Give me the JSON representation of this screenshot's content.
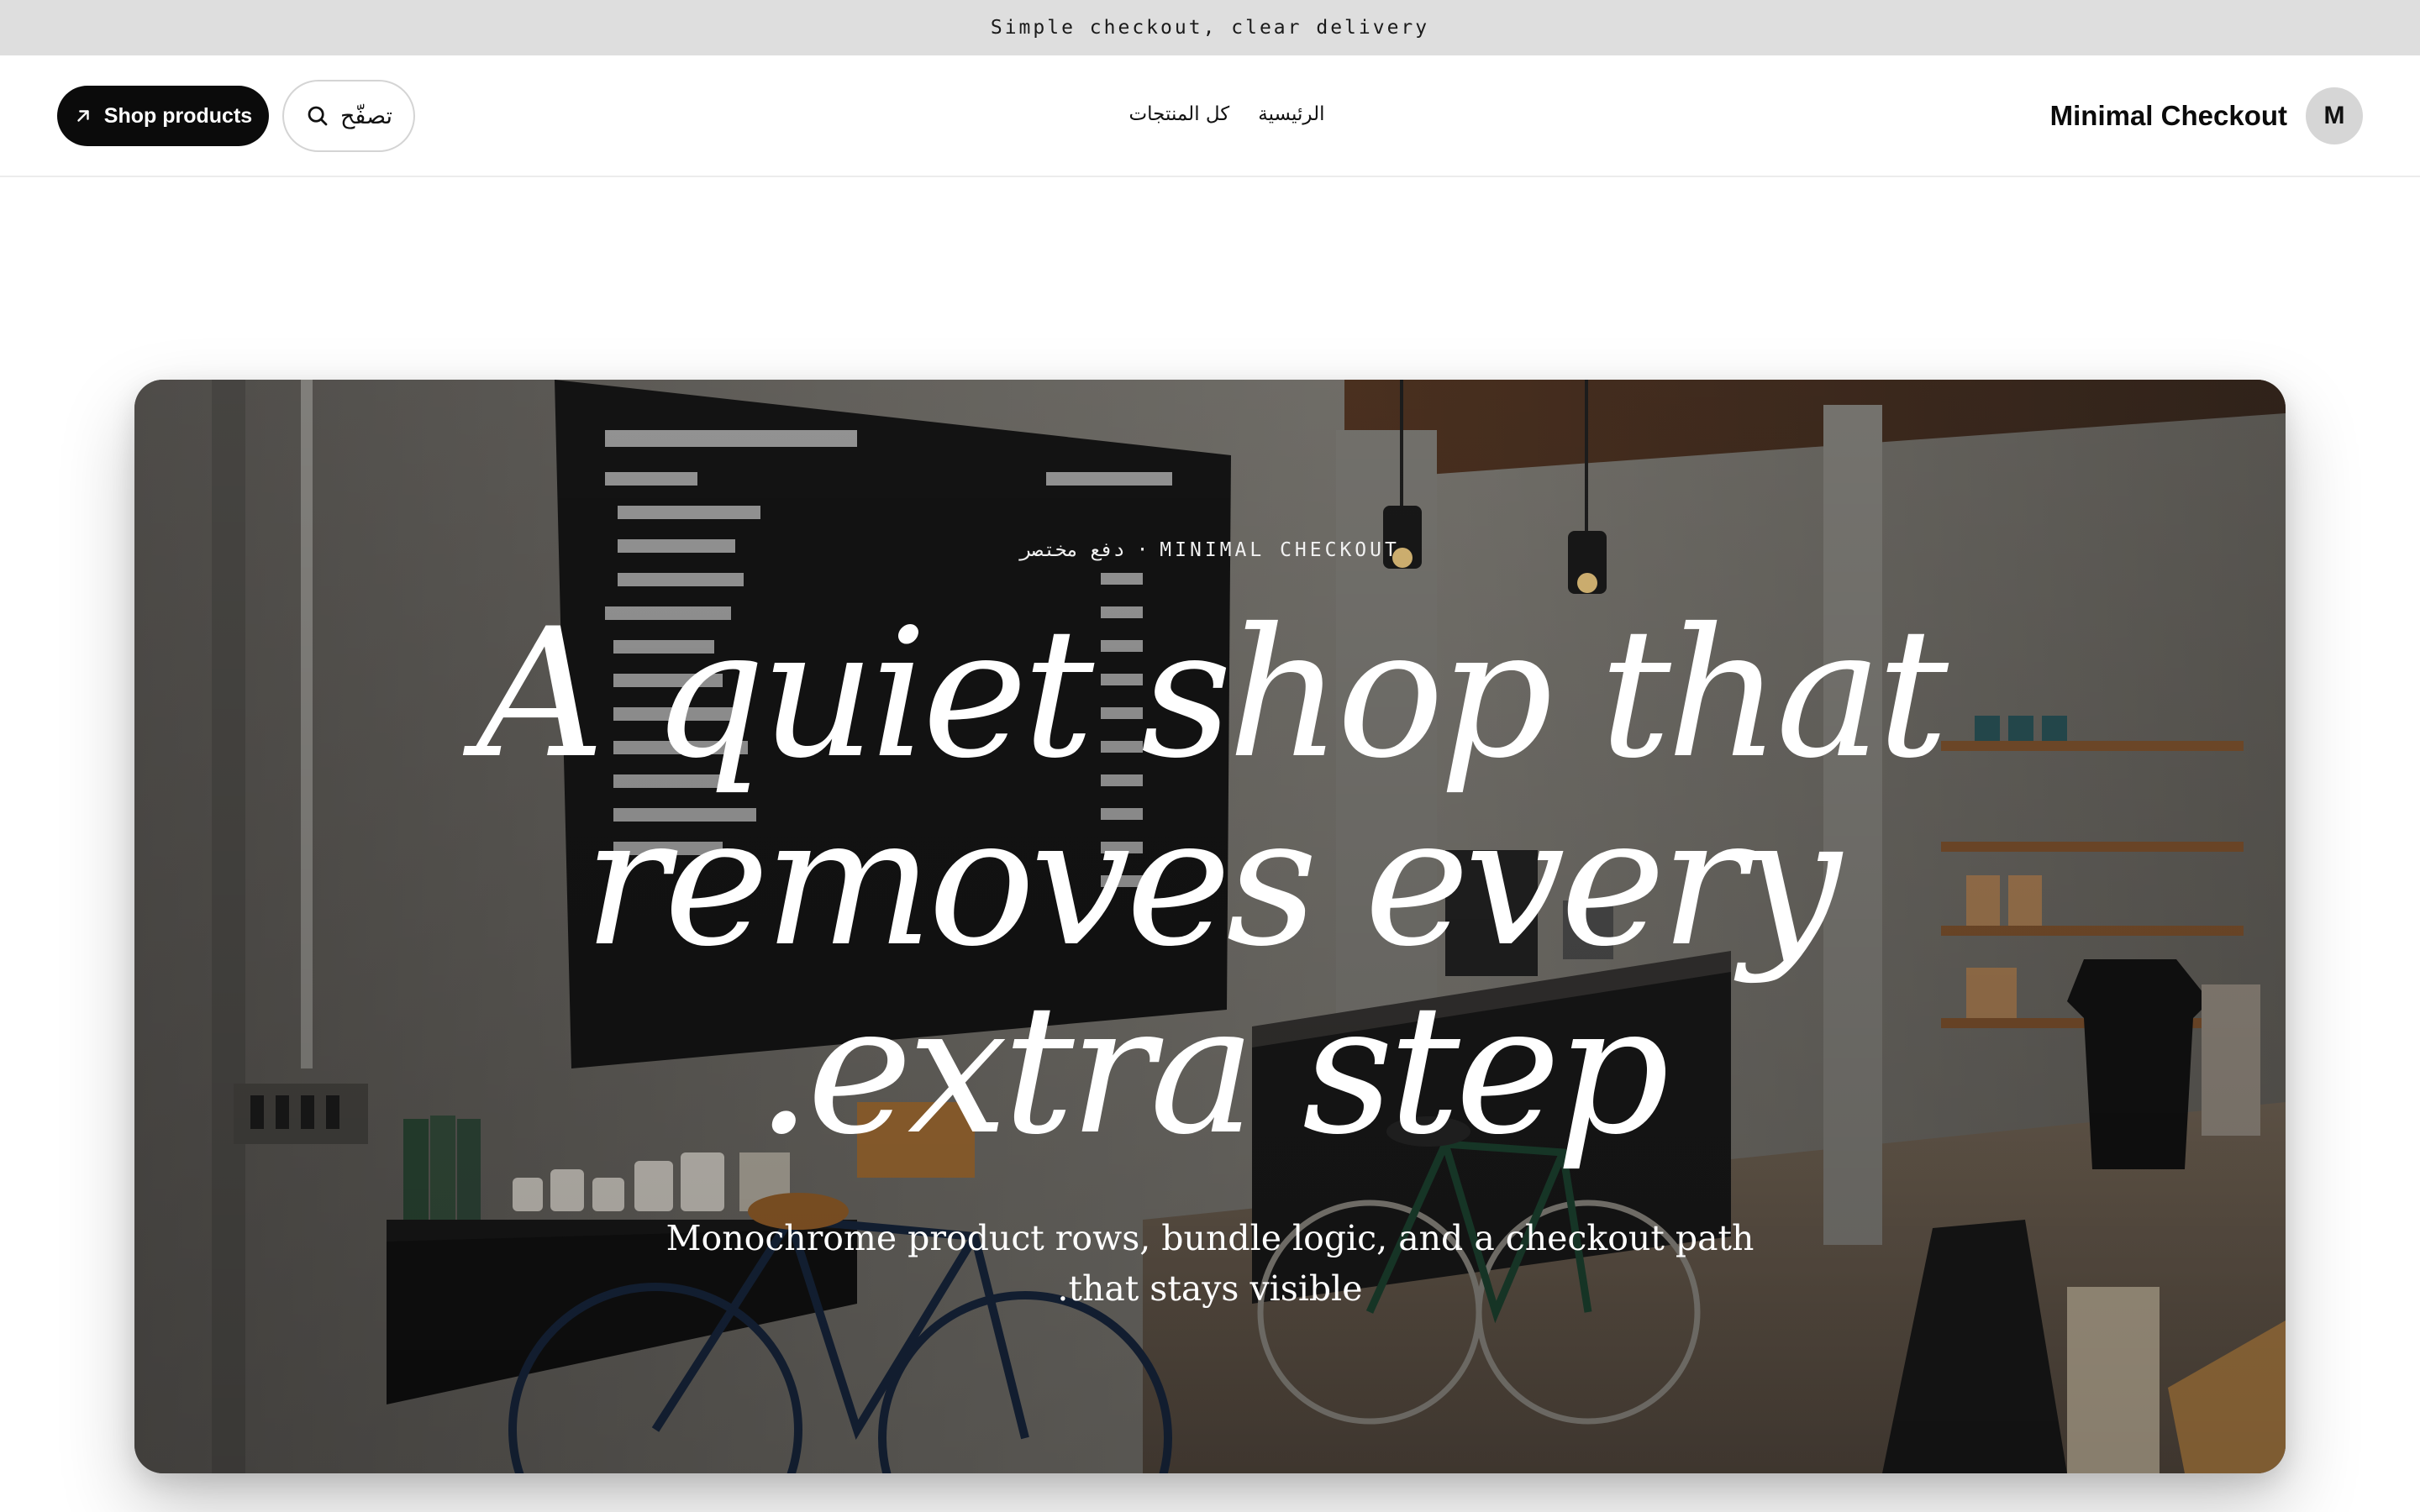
{
  "announcement": {
    "text": "Simple checkout, clear delivery"
  },
  "header": {
    "shop_button_label": "Shop products",
    "browse_button_label": "تصفّح",
    "nav": [
      {
        "label": "الرئيسية"
      },
      {
        "label": "كل المنتجات"
      }
    ],
    "brand_name": "Minimal Checkout",
    "avatar_initial": "M"
  },
  "hero": {
    "eyebrow": "دفع مختصر · MINIMAL CHECKOUT",
    "headline": "A quiet shop that removes every extra step.",
    "subheadline": "Monochrome product rows, bundle logic, and a checkout path that stays visible."
  },
  "icons": {
    "shop_button_icon": "arrow-up-right-icon",
    "browse_button_icon": "search-icon"
  },
  "colors": {
    "accent": "#0b0b0b",
    "announcement_bg": "#dedede",
    "avatar_bg": "#d6d6d6",
    "hero_text": "#ffffff"
  }
}
